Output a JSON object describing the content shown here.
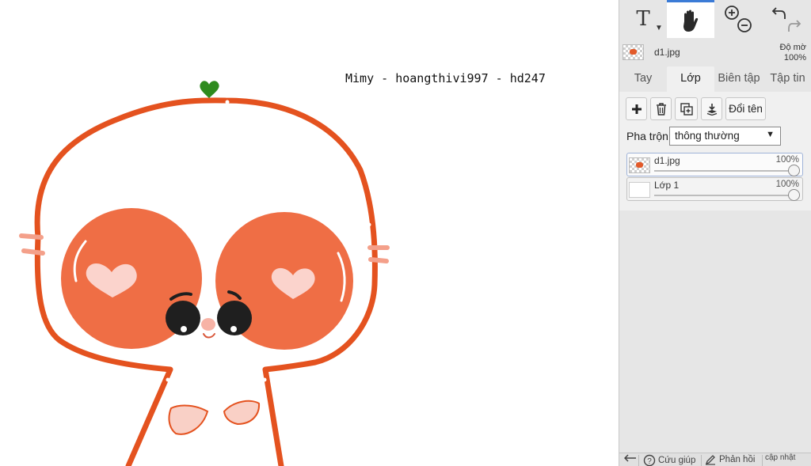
{
  "canvas": {
    "caption": "Mimy - hoangthivi997 - hd247",
    "colors": {
      "outline": "#e4521f",
      "cheek": "#ef6e45",
      "heart_stem": "#2e8b1e",
      "blush": "#f7b3a6"
    }
  },
  "toolbar": {
    "tools": [
      {
        "name": "text-tool",
        "icon": "text-T-icon",
        "label": "T"
      },
      {
        "name": "hand-tool",
        "icon": "hand-icon",
        "active": true
      },
      {
        "name": "zoom-tool",
        "icon": "zoom-in-out-icon"
      },
      {
        "name": "undo-redo",
        "icon": "undo-redo-icon"
      }
    ]
  },
  "file": {
    "name": "d1.jpg",
    "opacity_label": "Độ mờ",
    "opacity_value": "100%"
  },
  "tabs": [
    {
      "label": "Tay",
      "active": false
    },
    {
      "label": "Lớp",
      "active": true
    },
    {
      "label": "Biên tập",
      "active": false
    },
    {
      "label": "Tập tin",
      "active": false
    }
  ],
  "layer_actions": {
    "rename_label": "Đổi tên"
  },
  "blend": {
    "label": "Pha trộn",
    "value": "thông thường"
  },
  "layers": [
    {
      "name": "d1.jpg",
      "opacity": "100%",
      "opacity_level": 1.0,
      "selected": true
    },
    {
      "name": "Lớp 1",
      "opacity": "100%",
      "opacity_level": 1.0,
      "selected": false
    }
  ],
  "footer": {
    "help": "Cứu giúp",
    "feedback": "Phản hồi",
    "update": "cập nhật"
  },
  "accent_color": "#3b7bd6"
}
